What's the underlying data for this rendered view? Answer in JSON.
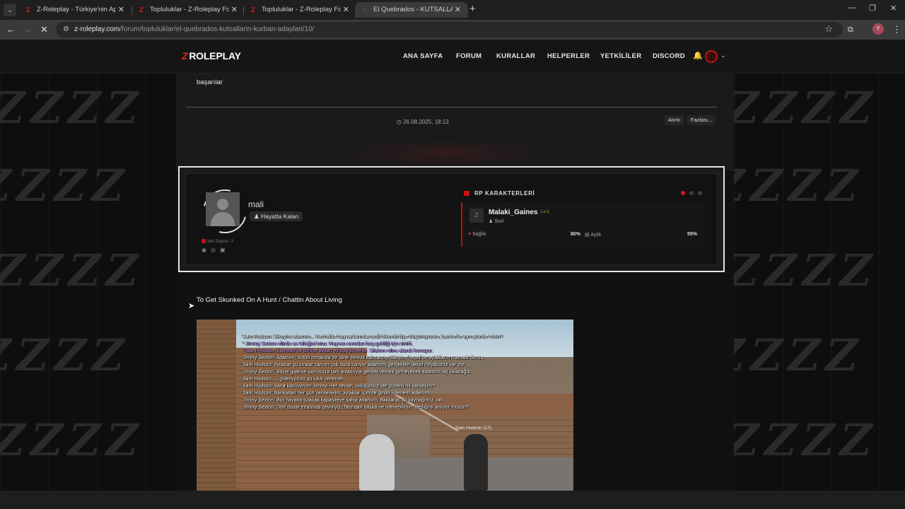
{
  "browser": {
    "tabs": [
      {
        "title": "Z-Roleplay - Türkiye'nin Apokal",
        "favicon": "z-logo"
      },
      {
        "title": "Topluluklar - Z-Roleplay Forum",
        "favicon": "z-logo"
      },
      {
        "title": "Topluluklar - Z-Roleplay Forum",
        "favicon": "z-logo"
      },
      {
        "title": "El Quebrados - KUTSALLARIN K",
        "favicon": "loading-globe"
      }
    ],
    "url_host": "z-roleplay.com",
    "url_path": "/forum/topluluklar/el-quebrados-kutsallarin-kurban-adaylari/10/",
    "profile_initial": "Y"
  },
  "site": {
    "logo_mark": "Z",
    "logo_text": "ROLEPLAY",
    "nav": [
      "ANA SAYFA",
      "FORUM",
      "KURALLAR",
      "HELPERLER",
      "YETKİLİLER",
      "DISCORD"
    ]
  },
  "previous_post": {
    "text": "başarılar",
    "date": "26.08.2025, 18:13",
    "quote_label": "Alıntı",
    "more_label": "Fazlası..."
  },
  "profile": {
    "username": "mali",
    "badge": "Hayatta Kalan",
    "message_count": "İleti Sayısı: 2",
    "rp_header": "RP KARAKTERLERİ",
    "character": {
      "name": "Malaki_Gaines",
      "level": "Lv.1",
      "role": "Sivil",
      "health_label": "Sağlık",
      "health_value": "80%",
      "hunger_label": "Açlık",
      "hunger_value": "55%"
    }
  },
  "post": {
    "title": "To Get Skunked On A Hunt / Chattin About Living",
    "chat_lines": [
      {
        "text": "Sam Hudson: Sikeyim adamım... Herhalde hayvanlarında nesli tükendi diye düşünüyorum, benim ile aynı yönde misin?",
        "me": false
      },
      {
        "text": "* Jimmy Sexton elinde av tüfeğini tutar. Hayvan avından boş geldiği için sinirli.",
        "me": true
      },
      {
        "text": "* Sam Hudson J.Sexton ile birlikte avdan eli boş dönerler. Silahını eline alarak konuşur.",
        "me": true
      },
      {
        "text": "Jimmy Sexton: Adamım, bütün ormanda bir tane domuz kalmamış. Sikiyim, hepsi bu aylakların mamasi olmuş.",
        "me": false
      },
      {
        "text": "Sam Hudson: Aylaklar şu sıralar canımı çok fazla sıkıyor adamım, gerçekten besin ihtiyacımız var zor ...",
        "me": false
      },
      {
        "text": "Jimmy Sexton: Böyle giderse karnımıza tam anlamıyla gerçek yemek girmeyecek adamım, aç kalacağız.",
        "me": false
      },
      {
        "text": "Sam Hudson: ... gideriyorum şu sikik yerlerde.",
        "me": false
      },
      {
        "text": "Sam Hudson: Sana katılıyorum Jimmy. Her neyse, olduğumuz yer güvenli mi kardeşim?",
        "me": false
      },
      {
        "text": "Sam Hudson: Barikatları her gün yenileyelim, aylaklar içimize girsin istemem adamım.",
        "me": false
      },
      {
        "text": "Jimmy Sexton: Bizi hayatta tutacak kapasiteye sahip adamım. Baksana, şu kaynağımız var.",
        "me": false
      },
      {
        "text": "Jimmy Sexton: Dört duvar etrafında çevriliyiz. Tanrıdan başka ne isteyebilirsin, dediğimi anlıyor musun?",
        "me": false
      }
    ],
    "nametag": "Sam Hudson (17)"
  }
}
